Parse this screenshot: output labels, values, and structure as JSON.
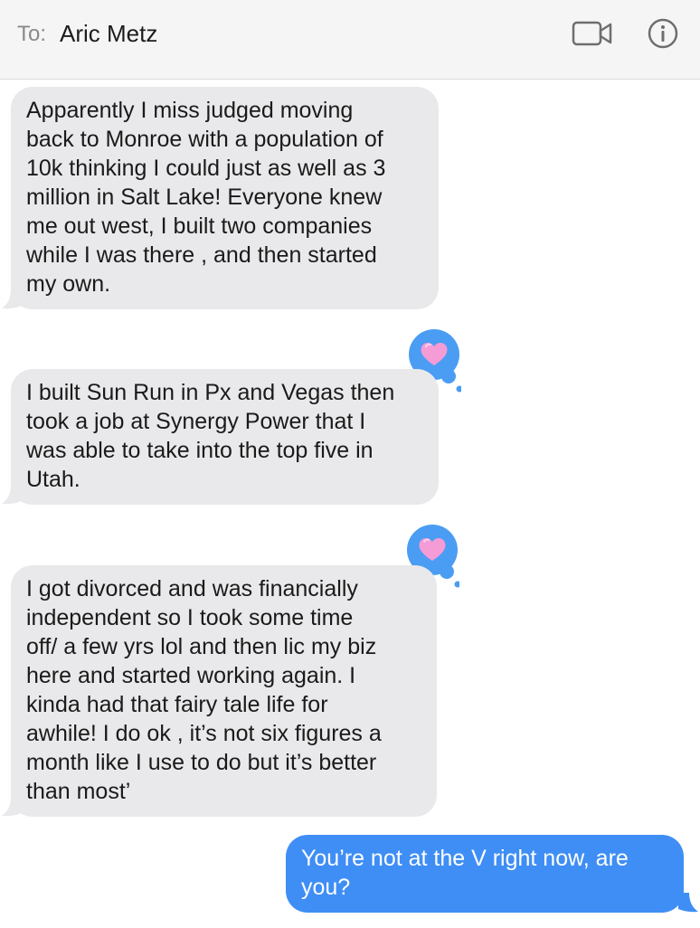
{
  "header": {
    "to_label": "To:",
    "recipient": "Aric Metz",
    "video_icon": "video-camera-icon",
    "info_icon": "info-icon"
  },
  "colors": {
    "incoming_bubble": "#e9e9eb",
    "outgoing_bubble": "#3f8ef5",
    "tapback_bubble": "#4a9df3",
    "heart": "#f59bd6"
  },
  "messages": [
    {
      "direction": "incoming",
      "lines": [
        "Apparently I miss judged moving",
        "back to Monroe with a population of",
        "10k thinking I could just as well as 3",
        "million in Salt Lake! Everyone knew",
        "me out west, I built two companies",
        "while I was there , and then started",
        "my own."
      ]
    },
    {
      "direction": "incoming",
      "tapback": "heart",
      "lines": [
        "I built Sun Run in Px and Vegas then",
        "took a job at Synergy Power that I",
        "was able to take into the top five in",
        "Utah."
      ]
    },
    {
      "direction": "incoming",
      "tapback": "heart",
      "lines": [
        "I got divorced and was financially",
        "independent so I took some time",
        "off/ a few yrs lol and then lic my biz",
        "here and started working again. I",
        "kinda had that fairy tale life for",
        "awhile! I do ok , it’s not six figures a",
        "month like I use to do but it’s better",
        "than most’"
      ]
    },
    {
      "direction": "outgoing",
      "lines": [
        "You’re not at the V right now, are",
        "you?"
      ]
    }
  ]
}
